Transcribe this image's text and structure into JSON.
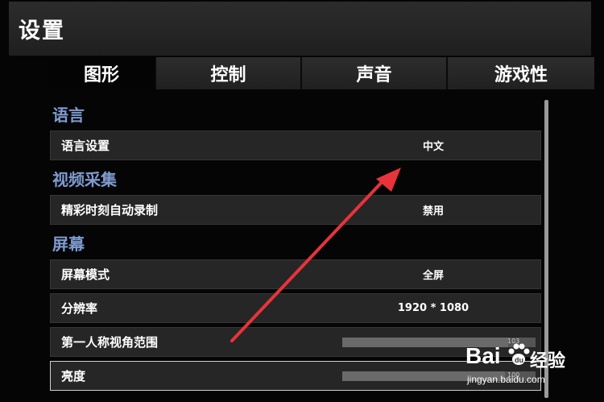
{
  "header": {
    "title": "设置"
  },
  "tabs": [
    {
      "label": "图形",
      "active": true
    },
    {
      "label": "控制",
      "active": false
    },
    {
      "label": "声音",
      "active": false
    },
    {
      "label": "游戏性",
      "active": false
    }
  ],
  "sections": {
    "language": {
      "title": "语言",
      "rows": [
        {
          "label": "语言设置",
          "value": "中文"
        }
      ]
    },
    "video_capture": {
      "title": "视频采集",
      "rows": [
        {
          "label": "精彩时刻自动录制",
          "value": "禁用"
        }
      ]
    },
    "screen": {
      "title": "屏幕",
      "rows": [
        {
          "label": "屏幕模式",
          "value": "全屏"
        },
        {
          "label": "分辨率",
          "value": "1920 * 1080"
        },
        {
          "label": "第一人称视角范围",
          "value": "103",
          "slider_fraction": 0.86
        },
        {
          "label": "亮度",
          "value": "100",
          "slider_fraction": 0.84
        }
      ]
    }
  },
  "annotation": {
    "arrow_color": "#e8333a"
  },
  "watermark": {
    "brand": "Bai",
    "brand_suffix": "du",
    "cn": "经验",
    "url": "jingyan.baidu.com"
  },
  "colors": {
    "section_title": "#7f9bd0",
    "row_bg": "#262626",
    "background": "#050505"
  }
}
